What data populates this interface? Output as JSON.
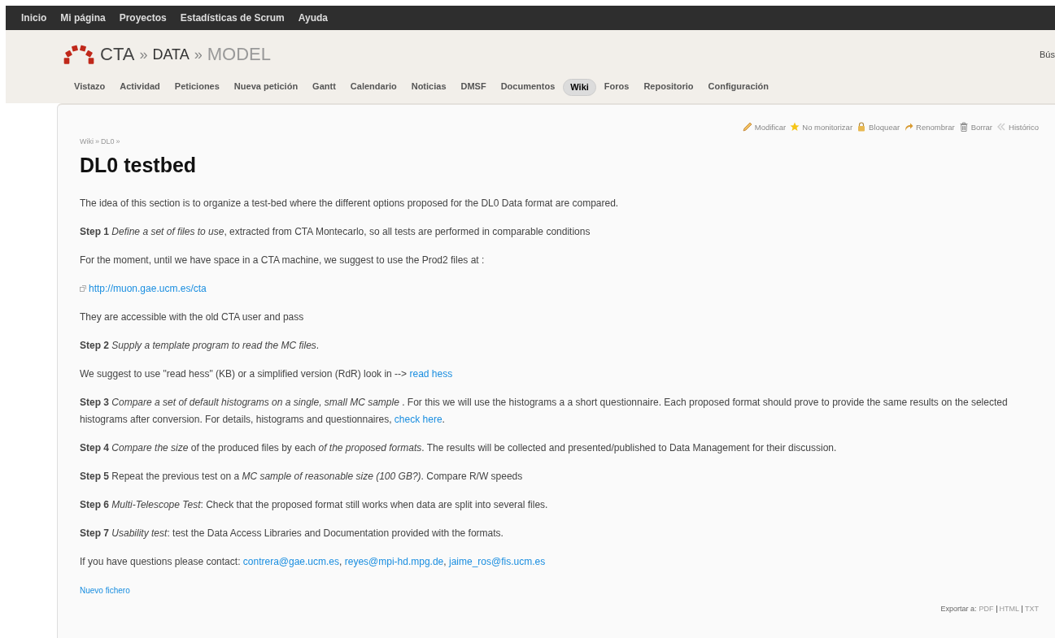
{
  "top_menu": [
    "Inicio",
    "Mi página",
    "Proyectos",
    "Estadísticas de Scrum",
    "Ayuda"
  ],
  "header": {
    "project": "CTA",
    "sep1": "»",
    "subproject": "DATA",
    "sep2": "»",
    "current": "MODEL",
    "search_label": "Bús"
  },
  "tabs": [
    {
      "label": "Vistazo",
      "selected": false
    },
    {
      "label": "Actividad",
      "selected": false
    },
    {
      "label": "Peticiones",
      "selected": false
    },
    {
      "label": "Nueva petición",
      "selected": false
    },
    {
      "label": "Gantt",
      "selected": false
    },
    {
      "label": "Calendario",
      "selected": false
    },
    {
      "label": "Noticias",
      "selected": false
    },
    {
      "label": "DMSF",
      "selected": false
    },
    {
      "label": "Documentos",
      "selected": false
    },
    {
      "label": "Wiki",
      "selected": true
    },
    {
      "label": "Foros",
      "selected": false
    },
    {
      "label": "Repositorio",
      "selected": false
    },
    {
      "label": "Configuración",
      "selected": false
    }
  ],
  "actions": [
    {
      "label": "Modificar",
      "kind": "pencil"
    },
    {
      "label": "No monitorizar",
      "kind": "star"
    },
    {
      "label": "Bloquear",
      "kind": "lock"
    },
    {
      "label": "Renombrar",
      "kind": "arrow"
    },
    {
      "label": "Borrar",
      "kind": "trash"
    },
    {
      "label": "Histórico",
      "kind": "history"
    }
  ],
  "breadcrumb": [
    "Wiki",
    "»",
    "DL0",
    "»"
  ],
  "title": "DL0 testbed",
  "paragraphs": [
    [
      {
        "kind": "text",
        "text": "The idea of this section is to organize a test-bed where the different options proposed for the DL0 Data format are compared."
      }
    ],
    [
      {
        "kind": "text",
        "text": "**Step 1** *Define a set of files to use*, extracted from CTA Montecarlo, so all tests are performed in comparable conditions"
      }
    ],
    [
      {
        "kind": "text",
        "text": "For the moment, until we have space in a CTA machine, we suggest to use the Prod2 files at :"
      }
    ],
    [
      {
        "kind": "external",
        "text": "http://muon.gae.ucm.es/cta"
      }
    ],
    [
      {
        "kind": "text",
        "text": "They are accessible with the old CTA user and pass"
      }
    ],
    [
      {
        "kind": "text",
        "text": "**Step 2** *Supply a template program to read the MC files*."
      }
    ],
    [
      {
        "kind": "text",
        "text": "We suggest to use \"read hess\" (KB) or a simplified version (RdR) look in --> "
      },
      {
        "kind": "link",
        "text": "read hess"
      }
    ],
    [
      {
        "kind": "text",
        "text": "**Step 3** *Compare a set of default histograms on a single, small MC sample* . For this we will use the histograms a a short questionnaire. Each proposed format should prove to provide the same results on the selected histograms after conversion. For details, histograms and questionnaires, "
      },
      {
        "kind": "link",
        "text": "check here"
      },
      {
        "kind": "text",
        "text": "."
      }
    ],
    [
      {
        "kind": "text",
        "text": "**Step 4** *Compare the size* of the produced files by each *of the proposed formats*. The results will be collected and presented/published to Data Management for their discussion."
      }
    ],
    [
      {
        "kind": "text",
        "text": "**Step 5** Repeat the previous test on a *MC sample of reasonable size (100 GB?)*. Compare R/W speeds"
      }
    ],
    [
      {
        "kind": "text",
        "text": "**Step 6** *Multi-Telescope Test*: Check that the proposed format still works when data are split into several files."
      }
    ],
    [
      {
        "kind": "text",
        "text": "**Step 7** *Usability test*: test the Data Access Libraries and Documentation provided with the formats."
      }
    ],
    [
      {
        "kind": "text",
        "text": "If you have questions please contact: "
      },
      {
        "kind": "link",
        "text": "contrera@gae.ucm.es"
      },
      {
        "kind": "text",
        "text": ", "
      },
      {
        "kind": "link",
        "text": "reyes@mpi-hd.mpg.de"
      },
      {
        "kind": "text",
        "text": ", "
      },
      {
        "kind": "link",
        "text": "jaime_ros@fis.ucm.es"
      }
    ]
  ],
  "new_file": "Nuevo fichero",
  "export": {
    "label": "Exportar a:",
    "formats": [
      "PDF",
      "HTML",
      "TXT"
    ]
  }
}
